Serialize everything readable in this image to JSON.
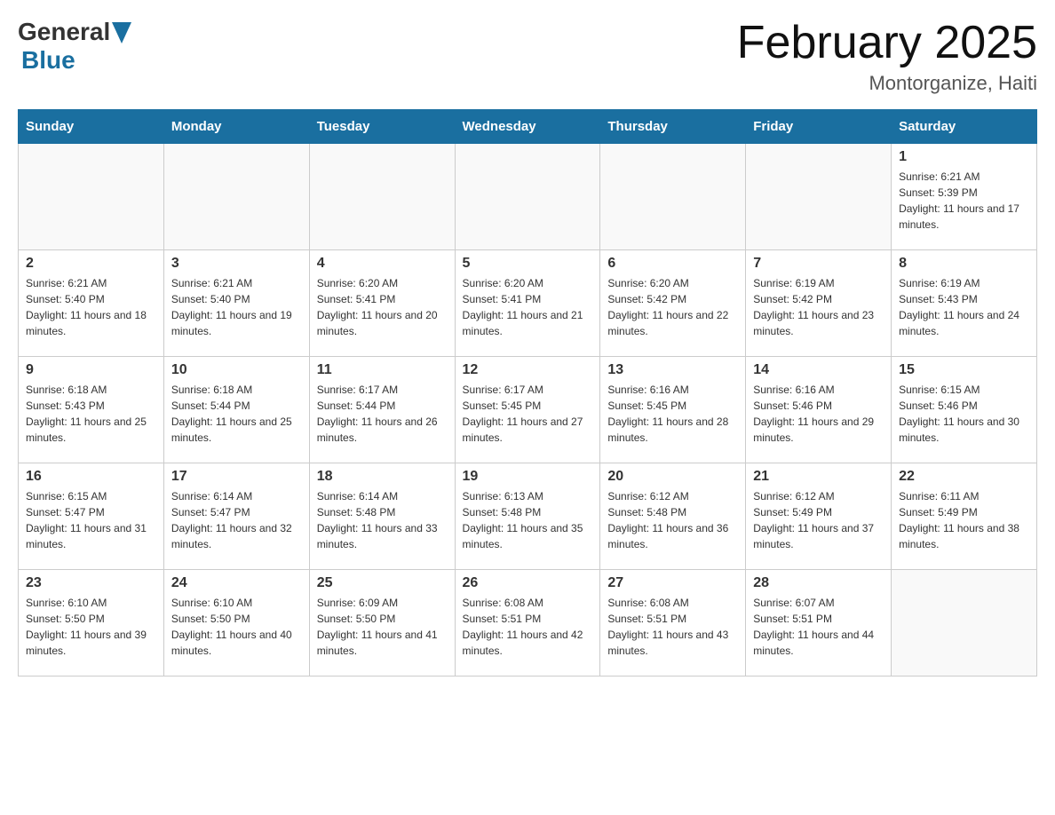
{
  "header": {
    "logo_general": "General",
    "logo_blue": "Blue",
    "month_title": "February 2025",
    "location": "Montorganize, Haiti"
  },
  "weekdays": [
    "Sunday",
    "Monday",
    "Tuesday",
    "Wednesday",
    "Thursday",
    "Friday",
    "Saturday"
  ],
  "weeks": [
    [
      {
        "day": "",
        "info": ""
      },
      {
        "day": "",
        "info": ""
      },
      {
        "day": "",
        "info": ""
      },
      {
        "day": "",
        "info": ""
      },
      {
        "day": "",
        "info": ""
      },
      {
        "day": "",
        "info": ""
      },
      {
        "day": "1",
        "info": "Sunrise: 6:21 AM\nSunset: 5:39 PM\nDaylight: 11 hours and 17 minutes."
      }
    ],
    [
      {
        "day": "2",
        "info": "Sunrise: 6:21 AM\nSunset: 5:40 PM\nDaylight: 11 hours and 18 minutes."
      },
      {
        "day": "3",
        "info": "Sunrise: 6:21 AM\nSunset: 5:40 PM\nDaylight: 11 hours and 19 minutes."
      },
      {
        "day": "4",
        "info": "Sunrise: 6:20 AM\nSunset: 5:41 PM\nDaylight: 11 hours and 20 minutes."
      },
      {
        "day": "5",
        "info": "Sunrise: 6:20 AM\nSunset: 5:41 PM\nDaylight: 11 hours and 21 minutes."
      },
      {
        "day": "6",
        "info": "Sunrise: 6:20 AM\nSunset: 5:42 PM\nDaylight: 11 hours and 22 minutes."
      },
      {
        "day": "7",
        "info": "Sunrise: 6:19 AM\nSunset: 5:42 PM\nDaylight: 11 hours and 23 minutes."
      },
      {
        "day": "8",
        "info": "Sunrise: 6:19 AM\nSunset: 5:43 PM\nDaylight: 11 hours and 24 minutes."
      }
    ],
    [
      {
        "day": "9",
        "info": "Sunrise: 6:18 AM\nSunset: 5:43 PM\nDaylight: 11 hours and 25 minutes."
      },
      {
        "day": "10",
        "info": "Sunrise: 6:18 AM\nSunset: 5:44 PM\nDaylight: 11 hours and 25 minutes."
      },
      {
        "day": "11",
        "info": "Sunrise: 6:17 AM\nSunset: 5:44 PM\nDaylight: 11 hours and 26 minutes."
      },
      {
        "day": "12",
        "info": "Sunrise: 6:17 AM\nSunset: 5:45 PM\nDaylight: 11 hours and 27 minutes."
      },
      {
        "day": "13",
        "info": "Sunrise: 6:16 AM\nSunset: 5:45 PM\nDaylight: 11 hours and 28 minutes."
      },
      {
        "day": "14",
        "info": "Sunrise: 6:16 AM\nSunset: 5:46 PM\nDaylight: 11 hours and 29 minutes."
      },
      {
        "day": "15",
        "info": "Sunrise: 6:15 AM\nSunset: 5:46 PM\nDaylight: 11 hours and 30 minutes."
      }
    ],
    [
      {
        "day": "16",
        "info": "Sunrise: 6:15 AM\nSunset: 5:47 PM\nDaylight: 11 hours and 31 minutes."
      },
      {
        "day": "17",
        "info": "Sunrise: 6:14 AM\nSunset: 5:47 PM\nDaylight: 11 hours and 32 minutes."
      },
      {
        "day": "18",
        "info": "Sunrise: 6:14 AM\nSunset: 5:48 PM\nDaylight: 11 hours and 33 minutes."
      },
      {
        "day": "19",
        "info": "Sunrise: 6:13 AM\nSunset: 5:48 PM\nDaylight: 11 hours and 35 minutes."
      },
      {
        "day": "20",
        "info": "Sunrise: 6:12 AM\nSunset: 5:48 PM\nDaylight: 11 hours and 36 minutes."
      },
      {
        "day": "21",
        "info": "Sunrise: 6:12 AM\nSunset: 5:49 PM\nDaylight: 11 hours and 37 minutes."
      },
      {
        "day": "22",
        "info": "Sunrise: 6:11 AM\nSunset: 5:49 PM\nDaylight: 11 hours and 38 minutes."
      }
    ],
    [
      {
        "day": "23",
        "info": "Sunrise: 6:10 AM\nSunset: 5:50 PM\nDaylight: 11 hours and 39 minutes."
      },
      {
        "day": "24",
        "info": "Sunrise: 6:10 AM\nSunset: 5:50 PM\nDaylight: 11 hours and 40 minutes."
      },
      {
        "day": "25",
        "info": "Sunrise: 6:09 AM\nSunset: 5:50 PM\nDaylight: 11 hours and 41 minutes."
      },
      {
        "day": "26",
        "info": "Sunrise: 6:08 AM\nSunset: 5:51 PM\nDaylight: 11 hours and 42 minutes."
      },
      {
        "day": "27",
        "info": "Sunrise: 6:08 AM\nSunset: 5:51 PM\nDaylight: 11 hours and 43 minutes."
      },
      {
        "day": "28",
        "info": "Sunrise: 6:07 AM\nSunset: 5:51 PM\nDaylight: 11 hours and 44 minutes."
      },
      {
        "day": "",
        "info": ""
      }
    ]
  ]
}
